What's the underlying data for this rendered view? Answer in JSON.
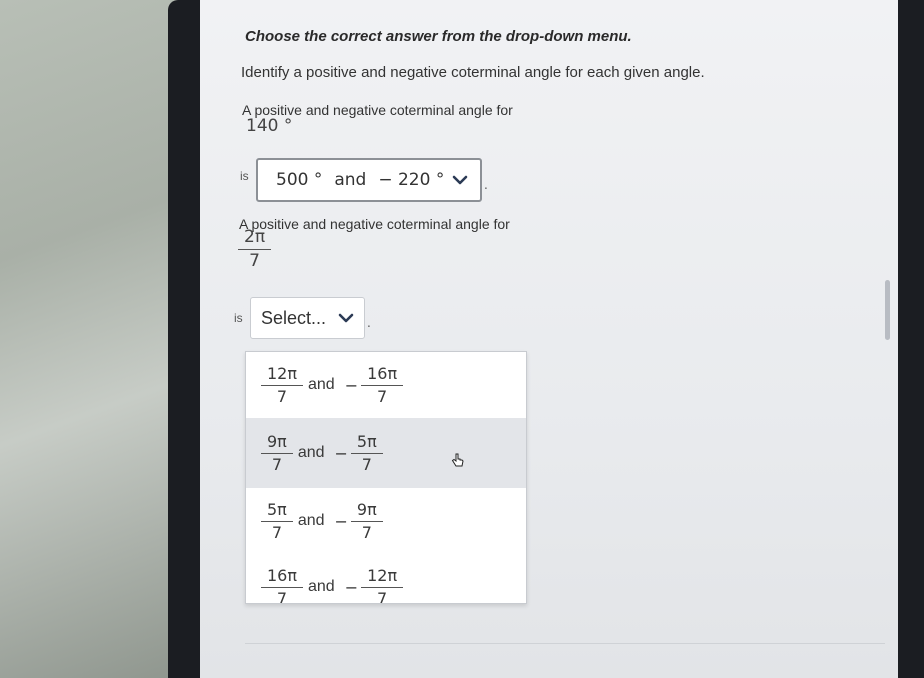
{
  "question": {
    "instruction": "Choose the correct answer from the drop-down menu.",
    "prompt": "Identify a positive and negative coterminal angle for each given angle.",
    "part1": {
      "label": "A positive and negative coterminal angle for",
      "angle": "140 °",
      "is": "is",
      "selected": {
        "positive": "500 °",
        "and": "and",
        "negative": "− 220 °"
      },
      "period": "."
    },
    "part2": {
      "label": "A positive and negative coterminal angle for",
      "angle_num": "2π",
      "angle_den": "7",
      "is": "is",
      "placeholder": "Select...",
      "period": "."
    }
  },
  "dropdown": {
    "options": [
      {
        "pos_num": "12π",
        "pos_den": "7",
        "and": "and",
        "minus": "−",
        "neg_num": "16π",
        "neg_den": "7"
      },
      {
        "pos_num": "9π",
        "pos_den": "7",
        "and": "and",
        "minus": "−",
        "neg_num": "5π",
        "neg_den": "7"
      },
      {
        "pos_num": "5π",
        "pos_den": "7",
        "and": "and",
        "minus": "−",
        "neg_num": "9π",
        "neg_den": "7"
      },
      {
        "pos_num": "16π",
        "pos_den": "7",
        "and": "and",
        "minus": "−",
        "neg_num": "12π",
        "neg_den": "7"
      }
    ],
    "hovered_index": 1
  },
  "icons": {
    "chevron": "chevron-down-icon",
    "cursor": "hand-pointer-icon"
  },
  "colors": {
    "chevron": "#2b3a55",
    "hover_bg": "#e3e5e9"
  }
}
